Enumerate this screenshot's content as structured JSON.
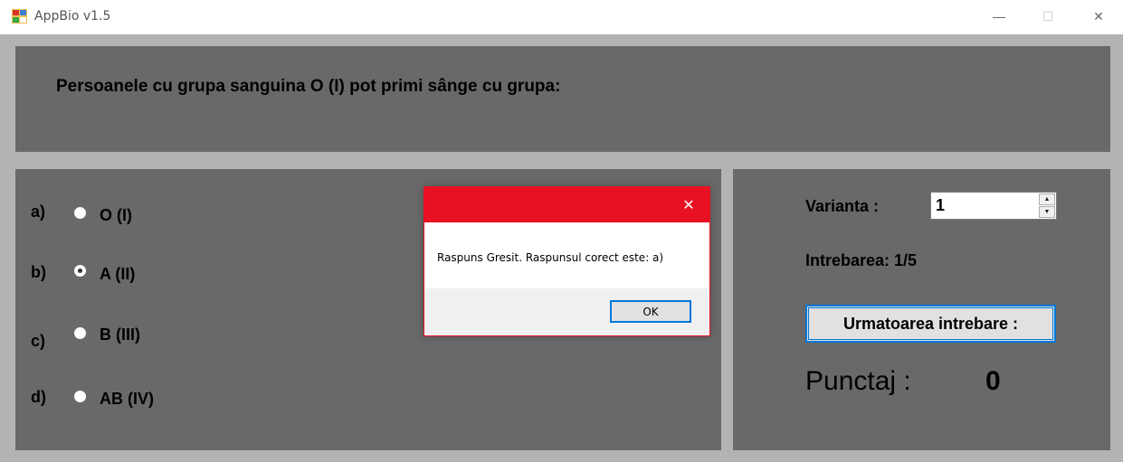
{
  "window": {
    "title": "AppBio v1.5",
    "icon": "app-icon",
    "minimize_glyph": "—",
    "maximize_glyph": "☐",
    "close_glyph": "✕"
  },
  "question": {
    "text": "Persoanele cu grupa sanguina O (I) pot primi sânge cu grupa:"
  },
  "options": [
    {
      "letter": "a)",
      "label": "O (I)",
      "checked": false
    },
    {
      "letter": "b)",
      "label": "A (II)",
      "checked": true
    },
    {
      "letter": "c)",
      "label": "B (III)",
      "checked": false
    },
    {
      "letter": "d)",
      "label": "AB (IV)",
      "checked": false
    }
  ],
  "side": {
    "variant_label": "Varianta :",
    "variant_value": "1",
    "question_counter": "Intrebarea: 1/5",
    "next_button": "Urmatoarea intrebare :",
    "score_label": "Punctaj :",
    "score_value": "0"
  },
  "dialog": {
    "message": "Raspuns Gresit. Raspunsul corect este: a)",
    "ok_label": "OK",
    "close_glyph": "✕"
  },
  "colors": {
    "panel": "#696969",
    "client_bg": "#b3b3b3",
    "dialog_accent": "#e81123",
    "focus_blue": "#0078d7"
  }
}
